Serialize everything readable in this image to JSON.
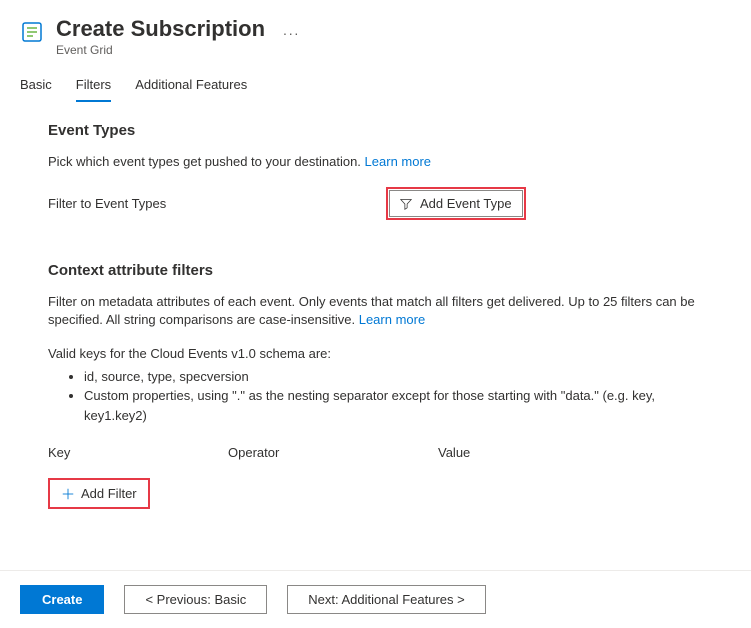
{
  "header": {
    "title": "Create Subscription",
    "subtitle": "Event Grid",
    "more": "···"
  },
  "tabs": {
    "basic": "Basic",
    "filters": "Filters",
    "additional": "Additional Features"
  },
  "eventTypes": {
    "title": "Event Types",
    "description": "Pick which event types get pushed to your destination.",
    "learnMore": "Learn more",
    "filterLabel": "Filter to Event Types",
    "addButton": "Add Event Type"
  },
  "contextFilters": {
    "title": "Context attribute filters",
    "description": "Filter on metadata attributes of each event. Only events that match all filters get delivered. Up to 25 filters can be specified. All string comparisons are case-insensitive.",
    "learnMore": "Learn more",
    "validKeysLabel": "Valid keys for the Cloud Events v1.0 schema are:",
    "bullets": [
      "id, source, type, specversion",
      "Custom properties, using \".\" as the nesting separator except for those starting with \"data.\" (e.g. key, key1.key2)"
    ],
    "columns": {
      "key": "Key",
      "operator": "Operator",
      "value": "Value"
    },
    "addFilter": "Add Filter"
  },
  "footer": {
    "create": "Create",
    "previous": "< Previous: Basic",
    "next": "Next: Additional Features >"
  }
}
